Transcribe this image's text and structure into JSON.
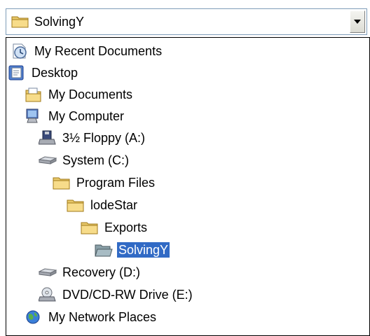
{
  "combo": {
    "current": "SolvingY",
    "icon": "folder-icon"
  },
  "items": [
    {
      "label": "My Recent Documents",
      "icon": "recent-documents-icon"
    },
    {
      "label": "Desktop",
      "icon": "desktop-icon"
    },
    {
      "label": "My Documents",
      "icon": "my-documents-icon"
    },
    {
      "label": "My Computer",
      "icon": "my-computer-icon"
    },
    {
      "label": "3½ Floppy (A:)",
      "icon": "floppy-drive-icon"
    },
    {
      "label": "System (C:)",
      "icon": "hard-drive-icon"
    },
    {
      "label": "Program Files",
      "icon": "folder-icon"
    },
    {
      "label": "lodeStar",
      "icon": "folder-icon"
    },
    {
      "label": "Exports",
      "icon": "folder-icon"
    },
    {
      "label": "SolvingY",
      "icon": "open-folder-icon",
      "selected": true
    },
    {
      "label": "Recovery (D:)",
      "icon": "hard-drive-icon"
    },
    {
      "label": "DVD/CD-RW Drive (E:)",
      "icon": "dvd-drive-icon"
    },
    {
      "label": "My Network Places",
      "icon": "network-places-icon"
    }
  ],
  "colors": {
    "selection": "#316ac5",
    "border": "#7f9db9"
  }
}
